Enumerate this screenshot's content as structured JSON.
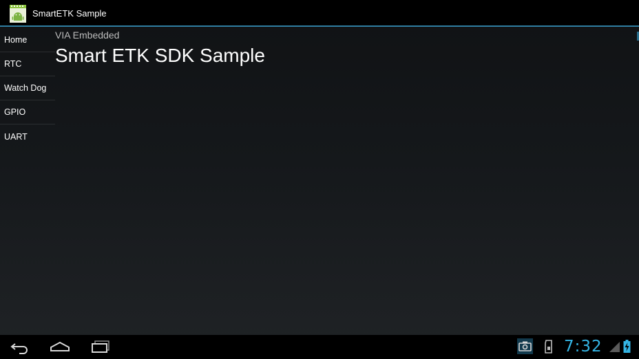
{
  "app": {
    "title": "SmartETK Sample",
    "icon": "android-app-icon"
  },
  "sidebar": {
    "items": [
      {
        "label": "Home"
      },
      {
        "label": "RTC"
      },
      {
        "label": "Watch Dog"
      },
      {
        "label": "GPIO"
      },
      {
        "label": "UART"
      }
    ]
  },
  "content": {
    "subtitle": "VIA Embedded",
    "headline": "Smart ETK SDK Sample"
  },
  "system_bar": {
    "time": "7:32",
    "icons": [
      "back-icon",
      "home-icon",
      "recent-apps-icon",
      "camera-notification-icon",
      "sd-card-notification-icon",
      "signal-icon",
      "battery-charging-icon"
    ]
  },
  "colors": {
    "accent": "#33b5e5",
    "action_bar": "#000000",
    "background_top": "#101214",
    "background_bottom": "#202326",
    "text_primary": "#ffffff",
    "text_secondary": "#bdbdbd",
    "divider": "#2b2e31"
  }
}
